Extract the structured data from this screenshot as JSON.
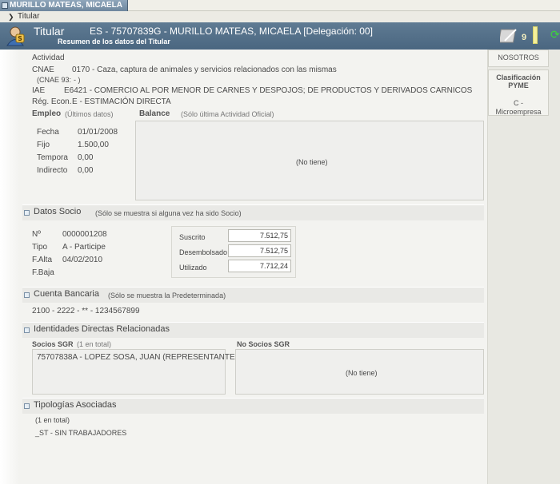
{
  "window": {
    "tab_title": "MURILLO MATEAS, MICAELA"
  },
  "breadcrumb": {
    "item": "Titular"
  },
  "header": {
    "title": "Titular",
    "subject": "ES - 75707839G - MURILLO MATEAS, MICAELA [Delegación: 00]",
    "subtitle": "Resumen de los datos del Titular",
    "count": "9"
  },
  "actividad": {
    "label": "Actividad",
    "cnae_label": "CNAE",
    "cnae_value": "0170 - Caza, captura de animales y servicios relacionados con las mismas",
    "cnae93_label": "(CNAE 93:",
    "cnae93_value": "- )",
    "iae_label": "IAE",
    "iae_value": "E6421 - COMERCIO AL POR MENOR DE CARNES Y DESPOJOS; DE PRODUCTOS Y DERIVADOS CARNICOS",
    "regimen_label": "Rég. Econ.",
    "regimen_value": "E - ESTIMACIÓN DIRECTA"
  },
  "empleo": {
    "label": "Empleo",
    "note": "(Últimos datos)",
    "rows": [
      {
        "label": "Fecha",
        "value": "01/01/2008"
      },
      {
        "label": "Fijo",
        "value": "1.500,00"
      },
      {
        "label": "Tempora",
        "value": "0,00"
      },
      {
        "label": "Indirecto",
        "value": "0,00"
      }
    ]
  },
  "balance": {
    "label": "Balance",
    "note": "(Sólo última Actividad Oficial)",
    "empty": "(No tiene)"
  },
  "datos_socio": {
    "title": "Datos Socio",
    "note": "(Sólo se muestra si alguna vez ha sido Socio)",
    "rows": [
      {
        "label": "Nº",
        "value": "0000001208"
      },
      {
        "label": "Tipo",
        "value": "A - Participe"
      },
      {
        "label": "F.Alta",
        "value": "04/02/2010"
      },
      {
        "label": "F.Baja",
        "value": ""
      }
    ],
    "suscrito_label": "Suscrito",
    "suscrito_value": "7.512,75",
    "desembolsado_label": "Desembolsado",
    "desembolsado_value": "7.512,75",
    "utilizado_label": "Utilizado",
    "utilizado_value": "7.712,24"
  },
  "cuenta": {
    "title": "Cuenta Bancaria",
    "note": "(Sólo se muestra la Predeterminada)",
    "value": "2100 - 2222 - ** - 1234567899"
  },
  "identidades": {
    "title": "Identidades Directas Relacionadas",
    "socios_label": "Socios SGR",
    "socios_note": "(1 en total)",
    "socios_item": "75707838A - LOPEZ SOSA, JUAN (REPRESENTANTE",
    "nosocios_label": "No Socios SGR",
    "nosocios_empty": "(No tiene)"
  },
  "tipologias": {
    "title": "Tipologías Asociadas",
    "note": "(1 en total)",
    "item": "_ST - SIN TRABAJADORES"
  },
  "right": {
    "card1": "NOSOTROS",
    "card2_title_1": "Clasificación",
    "card2_title_2": "PYME",
    "card2_value_1": "C -",
    "card2_value_2": "Microempresa"
  }
}
